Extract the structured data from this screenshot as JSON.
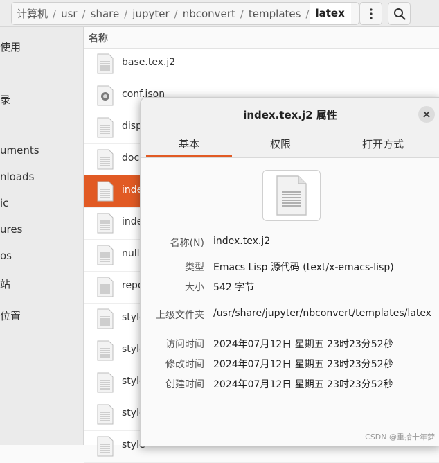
{
  "breadcrumb": [
    "计算机",
    "usr",
    "share",
    "jupyter",
    "nbconvert",
    "templates",
    "latex"
  ],
  "header": {
    "menu_icon": "kebab-menu-icon",
    "search_icon": "search-icon"
  },
  "sidebar": {
    "items": [
      {
        "label": "使用"
      },
      {
        "label": "录"
      },
      {
        "label": "uments"
      },
      {
        "label": "nloads"
      },
      {
        "label": "ic"
      },
      {
        "label": "ures"
      },
      {
        "label": "os"
      },
      {
        "label": "站"
      },
      {
        "label": "位置"
      }
    ]
  },
  "file_list": {
    "column_header": "名称",
    "files": [
      {
        "name": "base.tex.j2",
        "icon": "text-file-icon"
      },
      {
        "name": "conf.json",
        "icon": "json-file-icon"
      },
      {
        "name": "disp",
        "icon": "text-file-icon"
      },
      {
        "name": "doc",
        "icon": "text-file-icon"
      },
      {
        "name": "inde",
        "icon": "text-file-icon",
        "selected": true
      },
      {
        "name": "inde",
        "icon": "text-file-icon"
      },
      {
        "name": "null.",
        "icon": "text-file-icon"
      },
      {
        "name": "repo",
        "icon": "text-file-icon"
      },
      {
        "name": "style",
        "icon": "text-file-icon"
      },
      {
        "name": "style",
        "icon": "text-file-icon"
      },
      {
        "name": "style",
        "icon": "text-file-icon"
      },
      {
        "name": "style",
        "icon": "text-file-icon"
      },
      {
        "name": "style",
        "icon": "text-file-icon"
      }
    ]
  },
  "dialog": {
    "title": "index.tex.j2 属性",
    "close_icon": "close-icon",
    "tabs": [
      "基本",
      "权限",
      "打开方式"
    ],
    "active_tab": "基本",
    "file_icon": "text-document-icon",
    "fields": {
      "name_label": "名称(N)",
      "name_value": "index.tex.j2",
      "type_label": "类型",
      "type_value": "Emacs Lisp 源代码 (text/x-emacs-lisp)",
      "size_label": "大小",
      "size_value": "542 字节",
      "parent_label": "上级文件夹",
      "parent_value": "/usr/share/jupyter/nbconvert/templates/latex",
      "accessed_label": "访问时间",
      "accessed_value": "2024年07月12日 星期五 23时23分52秒",
      "modified_label": "修改时间",
      "modified_value": "2024年07月12日 星期五 23时23分52秒",
      "created_label": "创建时间",
      "created_value": "2024年07月12日 星期五 23时23分52秒"
    }
  },
  "watermark": "CSDN @重拾十年梦",
  "colors": {
    "accent": "#e15a24",
    "selected_row": "#e15a24"
  }
}
